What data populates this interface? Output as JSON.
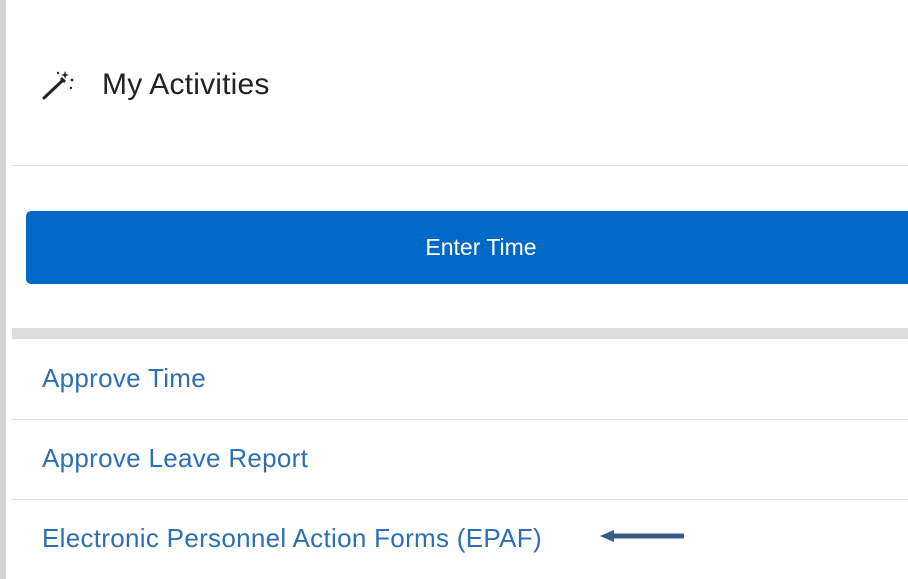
{
  "header": {
    "title": "My Activities",
    "icon": "magic-wand-icon"
  },
  "actions": {
    "enter_time_label": "Enter Time"
  },
  "links": [
    {
      "label": "Approve Time"
    },
    {
      "label": "Approve Leave Report"
    },
    {
      "label": "Electronic Personnel Action Forms (EPAF)"
    }
  ],
  "annotation": {
    "icon": "arrow-left-icon"
  },
  "colors": {
    "primary_button": "#0069c8",
    "link": "#2c6fb5",
    "arrow": "#3a5a85",
    "title": "#222222"
  }
}
